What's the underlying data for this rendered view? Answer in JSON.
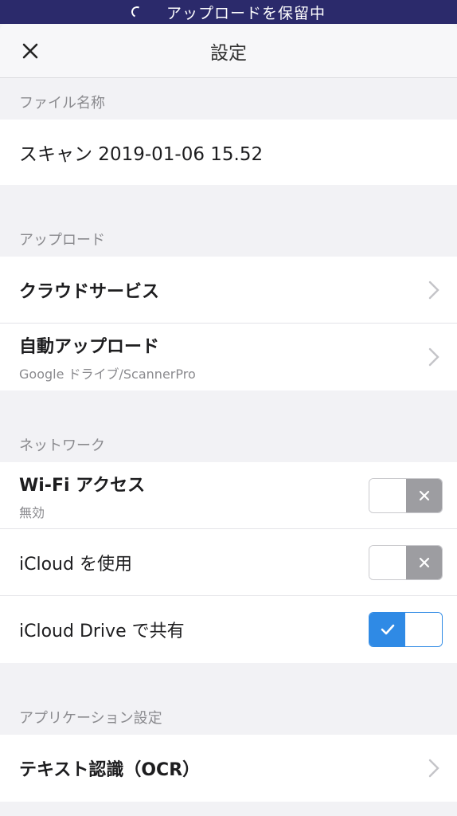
{
  "status_bar": {
    "text": "アップロードを保留中"
  },
  "navbar": {
    "title": "設定"
  },
  "sections": {
    "file_name": {
      "header": "ファイル名称",
      "value": "スキャン 2019-01-06 15.52"
    },
    "upload": {
      "header": "アップロード",
      "cloud_service": {
        "label": "クラウドサービス"
      },
      "auto_upload": {
        "label": "自動アップロード",
        "subtitle": "Google ドライブ/ScannerPro"
      }
    },
    "network": {
      "header": "ネットワーク",
      "wifi_access": {
        "label": "Wi-Fi アクセス",
        "subtitle": "無効",
        "enabled": false
      },
      "use_icloud": {
        "label": "iCloud を使用",
        "enabled": false
      },
      "icloud_drive_share": {
        "label": "iCloud Drive で共有",
        "enabled": true
      }
    },
    "app_settings": {
      "header": "アプリケーション設定",
      "ocr": {
        "label": "テキスト認識（OCR）"
      }
    }
  },
  "colors": {
    "status_bar_bg": "#2b2a6b",
    "toggle_on": "#2f8ae5",
    "toggle_off": "#9d9da1"
  }
}
